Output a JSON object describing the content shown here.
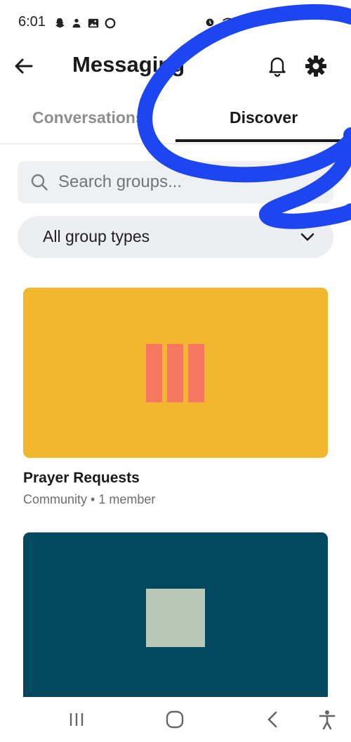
{
  "status_bar": {
    "time": "6:01"
  },
  "header": {
    "title": "Messaging"
  },
  "tabs": [
    {
      "label": "Conversations",
      "active": false
    },
    {
      "label": "Discover",
      "active": true
    }
  ],
  "search": {
    "placeholder": "Search groups..."
  },
  "filter": {
    "selected": "All group types"
  },
  "groups": [
    {
      "name": "Prayer Requests",
      "meta": "Community • 1 member",
      "cover_color": "#f1b82f",
      "art_color": "#f67860"
    },
    {
      "cover_color": "#02485f",
      "art_color": "#b7c8b4"
    }
  ],
  "icons": {
    "back": "arrow-left-icon",
    "notifications": "bell-icon",
    "settings": "gear-icon",
    "search": "search-icon",
    "dropdown": "chevron-down-icon"
  },
  "colors": {
    "accent_text": "#1a1a1a",
    "muted_text": "#8e8e8e",
    "annotation_stroke": "#1d46f0"
  }
}
